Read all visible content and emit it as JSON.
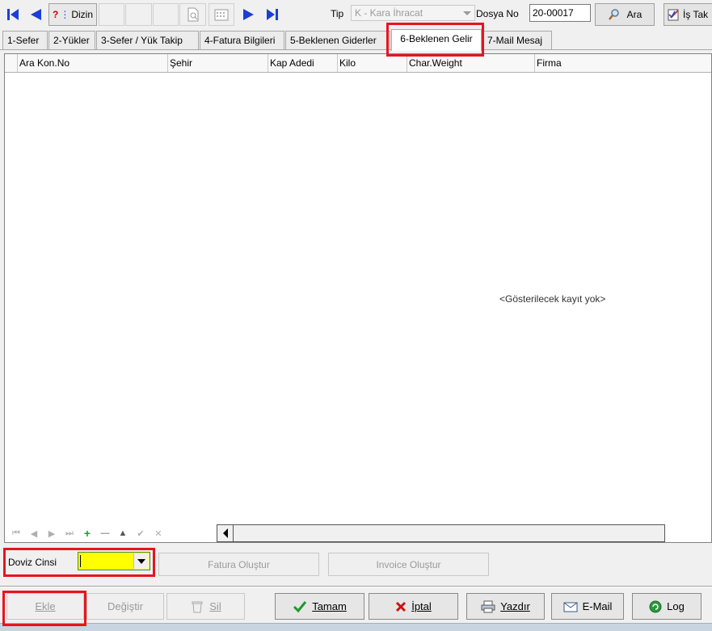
{
  "toolbar": {
    "first_icon": "first-record-icon",
    "prev_icon": "previous-record-icon",
    "dizin_label": "Dizin",
    "next_icon": "next-record-icon",
    "last_icon": "last-record-icon",
    "tip_label": "Tip",
    "tip_value": "K - Kara  İhracat",
    "dosya_label": "Dosya No",
    "dosya_value": "20-00017",
    "ara_label": "Ara",
    "is_takip_label": "İş Tak"
  },
  "tabs": [
    {
      "label": "1-Sefer"
    },
    {
      "label": "2-Yükler"
    },
    {
      "label": "3-Sefer / Yük Takip"
    },
    {
      "label": "4-Fatura Bilgileri"
    },
    {
      "label": "5-Beklenen Giderler"
    },
    {
      "label": "6-Beklenen Gelir",
      "active": true
    },
    {
      "label": "7-Mail Mesaj"
    }
  ],
  "grid": {
    "columns": [
      "Ara Kon.No",
      "Şehir",
      "Kap Adedi",
      "Kilo",
      "Char.Weight",
      "Firma"
    ],
    "empty_message": "<Gösterilecek kayıt yok>"
  },
  "bottom": {
    "doviz_label": "Doviz Cinsi",
    "doviz_value": "",
    "fatura_btn": "Fatura Oluştur",
    "invoice_btn": "Invoice Oluştur"
  },
  "buttons": {
    "ekle": "Ekle",
    "degistir": "Değiştir",
    "sil": "Sil",
    "tamam": "Tamam",
    "iptal": "İptal",
    "yazdir": "Yazdır",
    "email": "E-Mail",
    "log": "Log"
  },
  "colors": {
    "highlight": "#e8141c",
    "doviz_bg": "#ffff00",
    "nav_blue": "#1b3fd6"
  }
}
